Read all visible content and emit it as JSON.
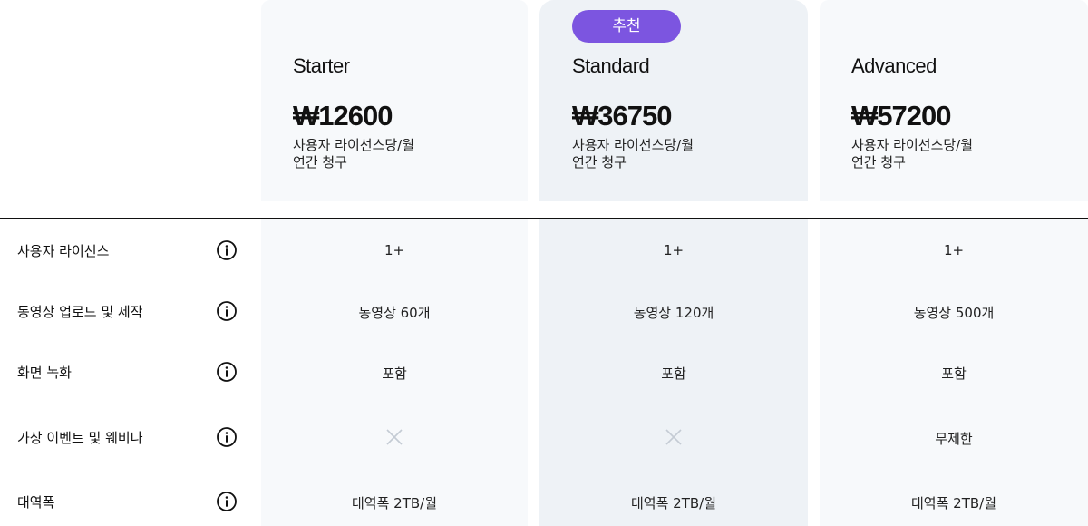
{
  "plans": [
    {
      "name": "Starter",
      "price": "₩12600",
      "unit": "사용자 라이선스당/월",
      "billing": "연간 청구"
    },
    {
      "name": "Standard",
      "price": "₩36750",
      "unit": "사용자 라이선스당/월",
      "billing": "연간 청구",
      "badge": "추천"
    },
    {
      "name": "Advanced",
      "price": "₩57200",
      "unit": "사용자 라이선스당/월",
      "billing": "연간 청구"
    }
  ],
  "features": [
    {
      "label": "사용자 라이선스",
      "values": [
        "1+",
        "1+",
        "1+"
      ]
    },
    {
      "label": "동영상 업로드 및 제작",
      "values": [
        "동영상 60개",
        "동영상 120개",
        "동영상 500개"
      ]
    },
    {
      "label": "화면 녹화",
      "values": [
        "포함",
        "포함",
        "포함"
      ]
    },
    {
      "label": "가상 이벤트 및 웨비나",
      "values": [
        "not-included-icon",
        "not-included-icon",
        "무제한"
      ]
    },
    {
      "label": "대역폭",
      "values": [
        "대역폭 2TB/월",
        "대역폭 2TB/월",
        "대역폭 2TB/월"
      ]
    }
  ],
  "colors": {
    "badge": "#7c55e0",
    "highlight_column": "#eef2f6",
    "column": "#f7f9fb"
  },
  "icons": {
    "info": "info-icon",
    "not_included": "x-icon"
  }
}
